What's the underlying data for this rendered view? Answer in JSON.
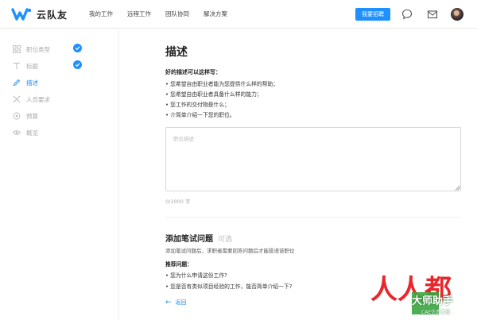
{
  "header": {
    "logo_text": "云队友",
    "nav": [
      "我的工作",
      "远程工作",
      "团队协同",
      "解决方案"
    ],
    "post_button": "我要招聘",
    "accent": "#1e90ff"
  },
  "sidebar": {
    "items": [
      {
        "label": "职位类型",
        "icon": "grid-icon",
        "done": true
      },
      {
        "label": "标题",
        "icon": "title-icon",
        "done": true
      },
      {
        "label": "描述",
        "icon": "pencil-icon",
        "active": true
      },
      {
        "label": "人员要求",
        "icon": "people-icon"
      },
      {
        "label": "预算",
        "icon": "budget-icon"
      },
      {
        "label": "概览",
        "icon": "eye-icon"
      }
    ]
  },
  "main": {
    "title": "描述",
    "tips_title": "好的描述可以这样写：",
    "tips": [
      "• 您希望自由职业者能为您提供什么样的帮助；",
      "• 您希望自由职业者具备什么样的能力；",
      "• 您工作的交付物是什么；",
      "• 介简单介绍一下您的职位。"
    ],
    "textarea": {
      "placeholder": "职位描述",
      "value": ""
    },
    "counter": "0/1000 字",
    "section_title": "添加笔试问题",
    "section_optional": "可选",
    "section_desc": "添加笔试问题后，求职者需要回答问题后才能投递该职位",
    "rec_title": "推荐问题：",
    "recommended": [
      "• 您为什么申请这份工作?",
      "• 您是否有类似项目经验的工作，能否简单介绍一下?"
    ],
    "back_label": "返回"
  },
  "watermark": {
    "brand": "人人都",
    "label": "大师助手",
    "sub": "CAE仿真工程"
  }
}
